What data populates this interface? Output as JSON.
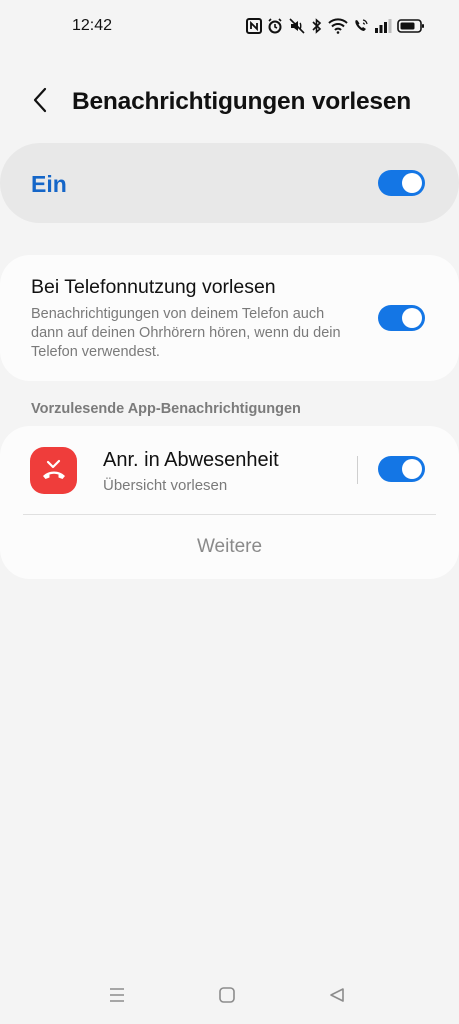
{
  "status_bar": {
    "time": "12:42",
    "icons": [
      "nfc-icon",
      "alarm-icon",
      "mute-icon",
      "bluetooth-icon",
      "wifi-icon",
      "wifi-call-icon",
      "signal-icon",
      "battery-icon"
    ]
  },
  "header": {
    "title": "Benachrichtigungen vorlesen",
    "back_icon": "back-arrow-icon"
  },
  "master_switch": {
    "label": "Ein",
    "enabled": true
  },
  "options": [
    {
      "title": "Bei Telefonnutzung vorlesen",
      "description": "Benachrichtigungen von deinem Telefon auch dann auf deinen Ohrhörern hören, wenn du dein Telefon verwendest.",
      "enabled": true
    }
  ],
  "app_section": {
    "header": "Vorzulesende App-Benachrichtigungen",
    "apps": [
      {
        "name": "Anr. in Abwesenheit",
        "subtitle": "Übersicht vorlesen",
        "icon": "missed-call-icon",
        "enabled": true
      }
    ],
    "more_label": "Weitere"
  },
  "nav_bar": {
    "icons": [
      "recents-icon",
      "home-icon",
      "back-icon"
    ]
  },
  "colors": {
    "accent": "#1476e5",
    "master_label": "#1566c8",
    "app_icon_bg": "#ef3d3b",
    "background": "#f4f4f4"
  }
}
